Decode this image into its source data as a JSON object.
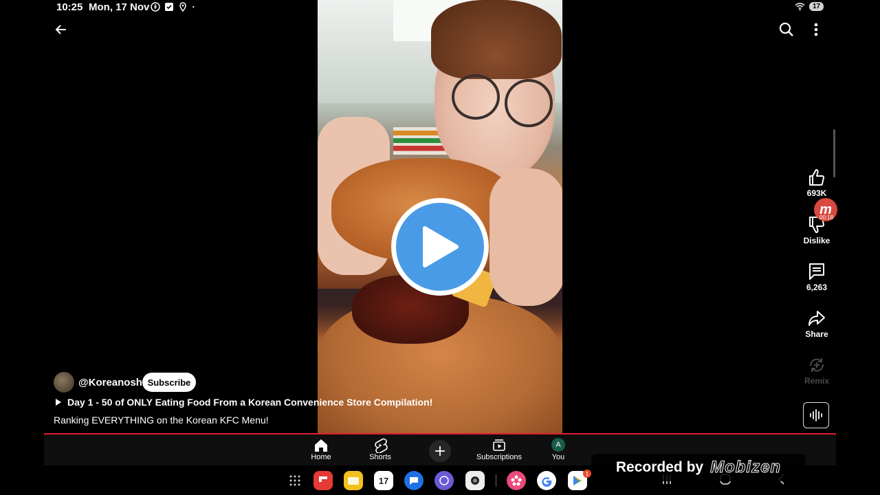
{
  "status_bar": {
    "time": "10:25",
    "date": "Mon, 17 Nov",
    "battery": "17"
  },
  "actions": {
    "like_count": "693K",
    "dislike_label": "Dislike",
    "comments_count": "6,263",
    "share_label": "Share",
    "remix_label": "Remix"
  },
  "channel": {
    "handle": "@Koreanosh",
    "subscribe_label": "Subscribe"
  },
  "video": {
    "title": "Day 1 - 50 of ONLY Eating Food From a Korean Convenience Store Compilation!",
    "description": "Ranking EVERYTHING on the Korean KFC Menu!"
  },
  "overlay": {
    "mobizen_badge": "m",
    "mobizen_time": "00:18"
  },
  "bottom_nav": {
    "home": "Home",
    "shorts": "Shorts",
    "subscriptions": "Subscriptions",
    "you": "You",
    "you_avatar_letter": "A"
  },
  "dock": {
    "calendar_day": "17",
    "play_store_badge": "1"
  },
  "recording": {
    "label": "Recorded by",
    "brand": "Mobizen"
  },
  "colors": {
    "accent_red": "#e21c2e",
    "play_blue": "#4a9be6"
  }
}
